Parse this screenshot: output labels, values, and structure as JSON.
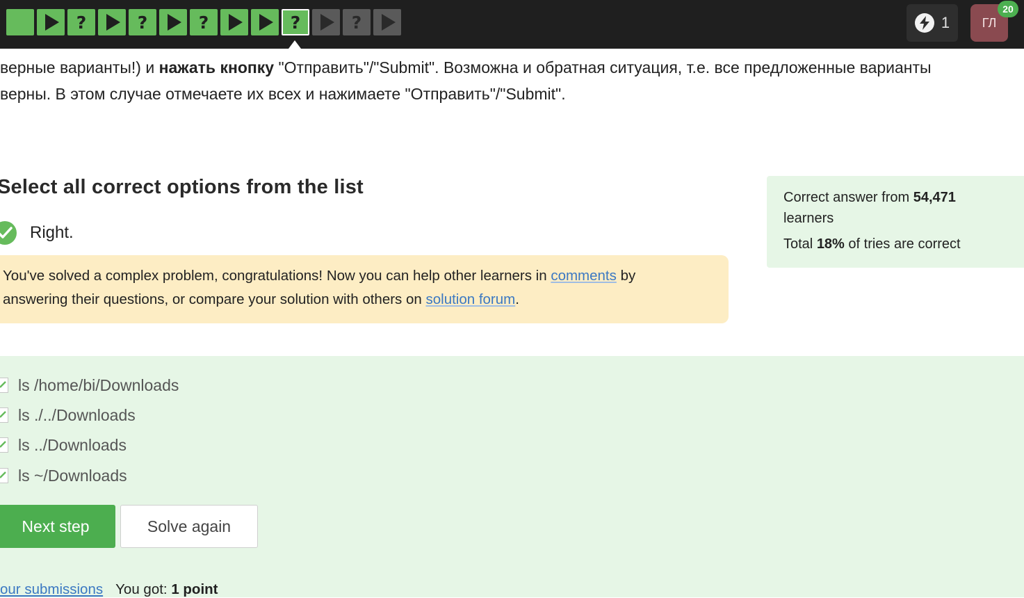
{
  "topbar": {
    "steps": [
      {
        "kind": "done",
        "symbol": ""
      },
      {
        "kind": "done",
        "symbol": "play"
      },
      {
        "kind": "done",
        "symbol": "?"
      },
      {
        "kind": "done",
        "symbol": "play"
      },
      {
        "kind": "done",
        "symbol": "?"
      },
      {
        "kind": "done",
        "symbol": "play"
      },
      {
        "kind": "done",
        "symbol": "?"
      },
      {
        "kind": "done",
        "symbol": "play"
      },
      {
        "kind": "done",
        "symbol": "play"
      },
      {
        "kind": "current",
        "symbol": "?"
      },
      {
        "kind": "todo",
        "symbol": "play"
      },
      {
        "kind": "todo",
        "symbol": "?"
      },
      {
        "kind": "todo",
        "symbol": "play"
      }
    ],
    "energy_count": "1",
    "avatar_initials": "ГЛ",
    "avatar_badge": "20"
  },
  "intro": {
    "line1_a": "верные варианты!) и ",
    "line1_bold": "нажать кнопку",
    "line1_b": " \"Отправить\"/\"Submit\". Возможна и обратная ситуация, т.е. все предложенные варианты",
    "line2": "верны. В этом случае отмечаете их всех и нажимаете \"Отправить\"/\"Submit\"."
  },
  "quiz": {
    "heading": "Select all correct options from the list",
    "result": "Right.",
    "notice_a": "You've solved a complex problem, congratulations! Now you can help other learners in ",
    "notice_link1": "comments",
    "notice_b": " by",
    "notice_c": "answering their questions, or compare your solution with others on ",
    "notice_link2": "solution forum",
    "notice_d": ".",
    "options": [
      "ls /home/bi/Downloads",
      "ls ./../Downloads",
      "ls ../Downloads",
      "ls ~/Downloads"
    ],
    "next_label": "Next step",
    "again_label": "Solve again",
    "submissions_link": "our submissions",
    "score_prefix": "You got: ",
    "score_value": "1 point"
  },
  "stats": {
    "line1_a": "Correct answer from ",
    "learners_count": "54,471",
    "line1_b": "learners",
    "line2_a": "Total ",
    "percent": "18%",
    "line2_b": " of tries are correct"
  },
  "colors": {
    "done": "#66bb5c",
    "todo": "#5a5a5a",
    "accent_green": "#4cae4f",
    "notice_bg": "#fdedc4",
    "panel_bg": "#e6f6e6",
    "link": "#3b78c2"
  }
}
